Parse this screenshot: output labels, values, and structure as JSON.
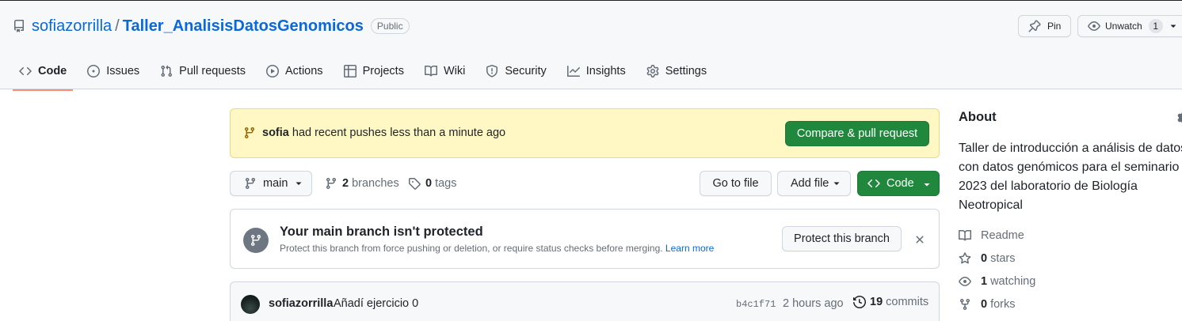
{
  "header": {
    "owner": "sofiazorrilla",
    "separator": "/",
    "repo": "Taller_AnalisisDatosGenomicos",
    "visibility": "Public",
    "pin_label": "Pin",
    "watch_label": "Unwatch",
    "watch_count": "1"
  },
  "nav": {
    "tabs": [
      {
        "label": "Code",
        "icon": "code-icon",
        "selected": true
      },
      {
        "label": "Issues",
        "icon": "issue-opened-icon"
      },
      {
        "label": "Pull requests",
        "icon": "git-pull-request-icon"
      },
      {
        "label": "Actions",
        "icon": "play-icon"
      },
      {
        "label": "Projects",
        "icon": "table-icon"
      },
      {
        "label": "Wiki",
        "icon": "book-icon"
      },
      {
        "label": "Security",
        "icon": "shield-icon"
      },
      {
        "label": "Insights",
        "icon": "graph-icon"
      },
      {
        "label": "Settings",
        "icon": "gear-icon"
      }
    ]
  },
  "flash": {
    "user": "sofia",
    "message": "had recent pushes less than a minute ago",
    "compare_button": "Compare & pull request"
  },
  "file_nav": {
    "branch": "main",
    "branches_count": "2",
    "branches_label": "branches",
    "tags_count": "0",
    "tags_label": "tags",
    "goto_file": "Go to file",
    "add_file": "Add file",
    "code_button": "Code"
  },
  "protection": {
    "title": "Your main branch isn't protected",
    "description": "Protect this branch from force pushing or deletion, or require status checks before merging.",
    "learn_more": "Learn more",
    "button": "Protect this branch"
  },
  "latest_commit": {
    "author": "sofiazorrilla",
    "message": "Añadí ejercicio 0",
    "sha": "b4c1f71",
    "time": "2 hours ago",
    "commits_count": "19",
    "commits_label": "commits"
  },
  "about": {
    "heading": "About",
    "description": "Taller de introducción a análisis de datos con datos genómicos para el seminario 2023 del laboratorio de Biología Neotropical",
    "readme": "Readme",
    "stars_count": "0",
    "stars_label": "stars",
    "watching_count": "1",
    "watching_label": "watching",
    "forks_count": "0",
    "forks_label": "forks"
  },
  "colors": {
    "accent_link": "#0969da",
    "primary_green": "#1f883d",
    "tab_underline": "#fd8c73",
    "flash_bg": "#fff8c5"
  }
}
